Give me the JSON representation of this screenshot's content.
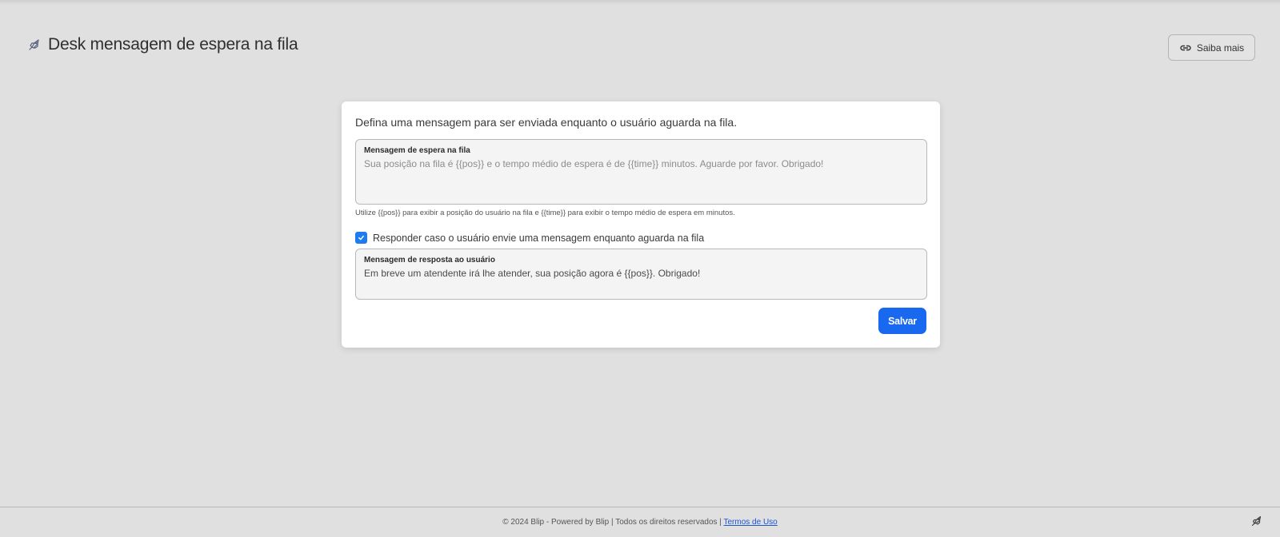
{
  "header": {
    "title": "Desk mensagem de espera na fila",
    "icon": "rocket-icon",
    "learn_more_label": "Saiba mais",
    "learn_more_icon": "link-icon"
  },
  "card": {
    "description": "Defina uma mensagem para ser enviada enquanto o usuário aguarda na fila.",
    "wait_message": {
      "label": "Mensagem de espera na fila",
      "placeholder": "Sua posição na fila é {{pos}} e o tempo médio de espera é de {{time}} minutos. Aguarde por favor. Obrigado!",
      "value": ""
    },
    "helper_text": "Utilize {{pos}} para exibir a posição do usuário na fila e {{time}} para exibir o tempo médio de espera em minutos.",
    "reply_checkbox": {
      "label": "Responder caso o usuário envie uma mensagem enquanto aguarda na fila",
      "checked": true
    },
    "reply_message": {
      "label": "Mensagem de resposta ao usuário",
      "value": "Em breve um atendente irá lhe atender, sua posição agora é {{pos}}. Obrigado!"
    },
    "save_label": "Salvar"
  },
  "footer": {
    "text": "© 2024 Blip - Powered by Blip | Todos os direitos reservados |",
    "terms_link": "Termos de Uso"
  },
  "colors": {
    "background": "#e0e0e0",
    "primary": "#1968f0",
    "checkbox": "#1e7bf0"
  }
}
